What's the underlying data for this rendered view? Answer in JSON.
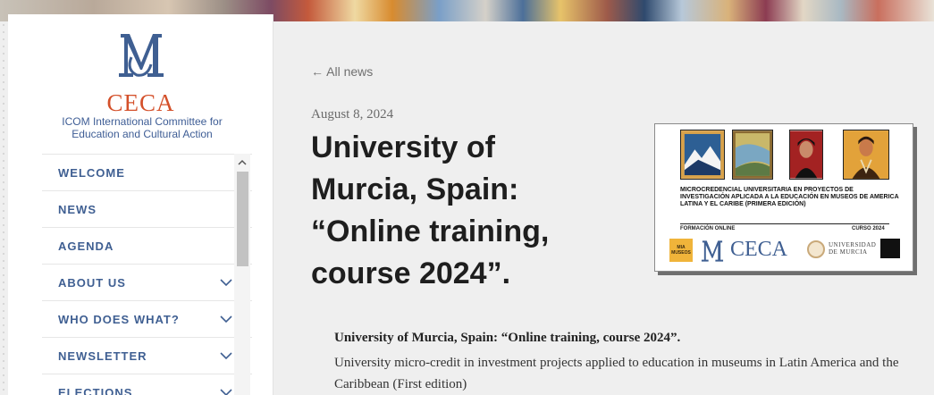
{
  "brand": {
    "name": "CECA",
    "subtitle": "ICOM International Committee for Education and Cultural Action",
    "logo_icon": "ceca-m-logo",
    "colors": {
      "accent": "#d4502a",
      "link": "#3f5f92"
    }
  },
  "nav": {
    "items": [
      {
        "label": "WELCOME",
        "has_submenu": false
      },
      {
        "label": "NEWS",
        "has_submenu": false
      },
      {
        "label": "AGENDA",
        "has_submenu": false
      },
      {
        "label": "ABOUT US",
        "has_submenu": true
      },
      {
        "label": "WHO DOES WHAT?",
        "has_submenu": true
      },
      {
        "label": "NEWSLETTER",
        "has_submenu": true
      },
      {
        "label": "ELECTIONS",
        "has_submenu": true
      }
    ]
  },
  "article": {
    "back_link": "← All news",
    "date": "August 8, 2024",
    "title": "University of Murcia, Spain: “Online training, course 2024”.",
    "intro_title": "University of Murcia, Spain: “Online training, course 2024”.",
    "intro_text": "University micro-credit in investment projects applied to education in museums in Latin America and the Caribbean (First edition)"
  },
  "poster": {
    "description": "MICROCREDENCIAL UNIVERSITARIA EN PROYECTOS DE INVESTIGACIÓN APLICADA A LA EDUCACIÓN EN MUSEOS DE AMERICA LATINA Y EL CARIBE (PRIMERA EDICIÓN)",
    "online_label": "FORMACIÓN ONLINE",
    "year_label": "CURSO 2024",
    "mia_label_1": "MIA",
    "mia_label_2": "MUSEOS",
    "ceca_label": "CECA",
    "univ_line_1": "UNIVERSIDAD",
    "univ_line_2": "DE MURCIA"
  }
}
